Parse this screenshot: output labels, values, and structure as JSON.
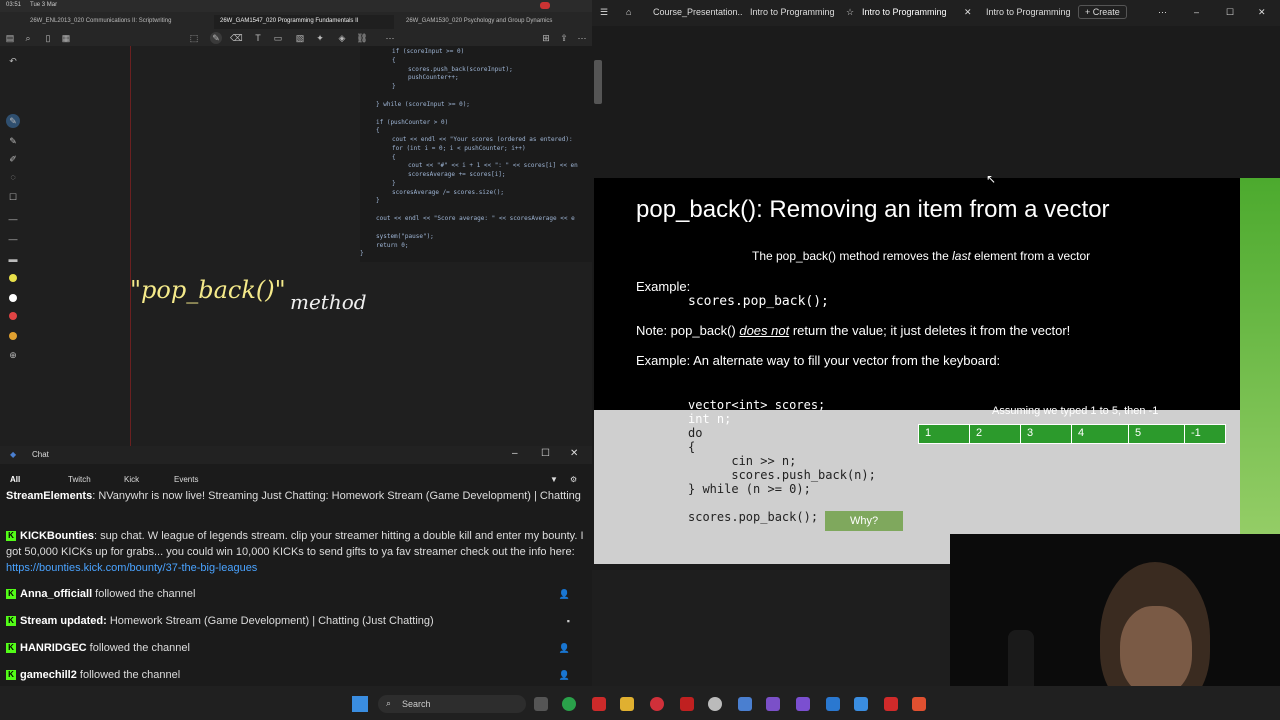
{
  "statusbar": {
    "time": "03:51",
    "date": "Tue 3 Mar"
  },
  "notes": {
    "tabs": [
      "26W_ENL2013_020 Communications II: Scriptwriting",
      "26W_GAM1547_020 Programming Fundamentals II",
      "26W_GAM1530_020 Psychology and Group Dynamics"
    ],
    "handwriting_main": "\"pop_back()\"",
    "handwriting_word": "method",
    "code_lines": [
      "if (scoreInput >= 0)",
      "{",
      "scores.push_back(scoreInput);",
      "pushCounter++;",
      "}",
      "} while (scoreInput >= 0);",
      "if (pushCounter > 0)",
      "{",
      "cout << endl << \"Your scores (ordered as entered):",
      "for (int i = 0; i < pushCounter; i++)",
      "{",
      "cout << \"#\" << i + 1 << \": \" << scores[i] << en",
      "scoresAverage += scores[i];",
      "}",
      "scoresAverage /= scores.size();",
      "}",
      "cout << endl << \"Score average: \" << scoresAverage << e",
      "system(\"pause\");",
      "return 0;",
      "}"
    ],
    "colors": {
      "margin": "#6b2020",
      "ink_yellow": "#f5ea8a",
      "ink_white": "#eeeeee"
    }
  },
  "chat": {
    "title": "Chat",
    "tabs": [
      "All",
      "Twitch",
      "Kick",
      "Events"
    ],
    "messages": [
      {
        "author": "StreamElements",
        "text": ": NVanywhr is now live! Streaming Just Chatting: Homework Stream (Game Development) | Chatting"
      },
      {
        "author": "KICKBounties",
        "text": ": sup chat. W league of legends stream. clip your streamer hitting a double kill and enter my bounty. I got 50,000 KICKs up for grabs... you could win 10,000 KICKs to send gifts to ya fav streamer check out the info here: ",
        "link": "https://bounties.kick.com/bounty/37-the-big-leagues"
      },
      {
        "author": "Anna_officiall",
        "text": " followed the channel"
      },
      {
        "author": "Stream updated:",
        "text": " Homework Stream (Game Development) | Chatting (Just Chatting)"
      },
      {
        "author": "HANRIDGEC",
        "text": " followed the channel"
      },
      {
        "author": "gamechill2",
        "text": " followed the channel"
      }
    ]
  },
  "browser": {
    "tabs": [
      "Course_Presentation..",
      "Intro to Programming",
      "Intro to Programming",
      "Intro to Programming",
      "Create"
    ]
  },
  "slide": {
    "title": "pop_back(): Removing an item from a vector",
    "subtitle_pre": "The pop_back() method removes the ",
    "subtitle_em": "last",
    "subtitle_post": " element from a vector",
    "example1_label": "Example:",
    "example1_code": "scores.pop_back();",
    "note_pre": "Note: pop_back() ",
    "note_em": "does not",
    "note_post": " return the value; it just deletes it from the vector!",
    "example2_label": "Example: An alternate way to fill your vector from the keyboard:",
    "code": [
      "vector<int> scores;",
      "int n;",
      "do",
      "{",
      "      cin >> n;",
      "      scores.push_back(n);",
      "} while (n >= 0);",
      "",
      "scores.pop_back();"
    ],
    "assume_text": "Assuming we typed 1 to 5, then -1",
    "array_cells": [
      "1",
      "2",
      "3",
      "4",
      "5",
      "-1"
    ],
    "why_button": "Why?",
    "colors": {
      "cell_green": "#2c9a2c",
      "why_green": "#7fa85d",
      "side_green": "#4caa2e"
    }
  },
  "taskbar": {
    "search_label": "Search"
  }
}
